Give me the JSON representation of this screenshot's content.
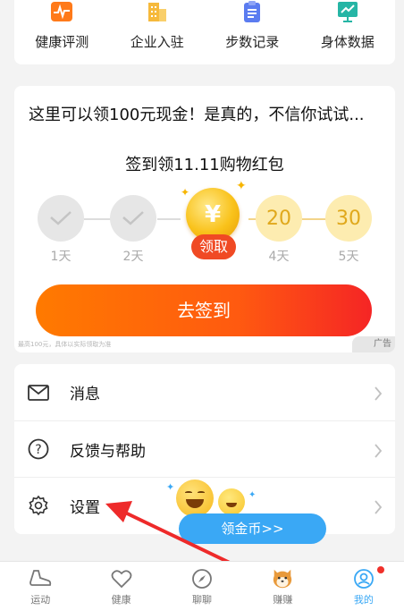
{
  "colors": {
    "orange_accent": "#ff7a00",
    "red_accent": "#f52525",
    "blue_accent": "#3aa8f5",
    "gold": "#f7b81a",
    "background": "#f3f3f3"
  },
  "shortcuts": [
    {
      "label": "健康评测",
      "icon": "heart-rate-icon",
      "color": "#ff7a1a"
    },
    {
      "label": "企业入驻",
      "icon": "building-icon",
      "color": "#f6b93b"
    },
    {
      "label": "步数记录",
      "icon": "clipboard-icon",
      "color": "#5b7cf0"
    },
    {
      "label": "身体数据",
      "icon": "chart-board-icon",
      "color": "#26b5a5"
    }
  ],
  "promo": {
    "headline": "这里可以领100元现金！是真的，不信你试试...",
    "subtitle": "签到领11.11购物红包",
    "steps": [
      {
        "day": "1天",
        "state": "done"
      },
      {
        "day": "2天",
        "state": "done"
      },
      {
        "day": "",
        "state": "current",
        "claim_label": "领取",
        "coin_symbol": "¥"
      },
      {
        "day": "4天",
        "value": "20",
        "state": "future"
      },
      {
        "day": "5天",
        "value": "30",
        "state": "future"
      }
    ],
    "button_label": "去签到",
    "fine_print": "最高100元，具体以实际领取为准",
    "ad_label": "广告"
  },
  "menu": {
    "items": [
      {
        "label": "消息",
        "icon": "mail-icon"
      },
      {
        "label": "反馈与帮助",
        "icon": "help-icon"
      },
      {
        "label": "设置",
        "icon": "settings-icon"
      }
    ]
  },
  "floating": {
    "label": "领金币>>"
  },
  "tabbar": {
    "tabs": [
      {
        "label": "运动",
        "icon": "shoe-icon"
      },
      {
        "label": "健康",
        "icon": "heart-icon"
      },
      {
        "label": "聊聊",
        "icon": "compass-icon"
      },
      {
        "label": "赚赚",
        "icon": "shiba-dog-icon"
      },
      {
        "label": "我的",
        "icon": "profile-icon",
        "active": true,
        "badge": true
      }
    ]
  }
}
